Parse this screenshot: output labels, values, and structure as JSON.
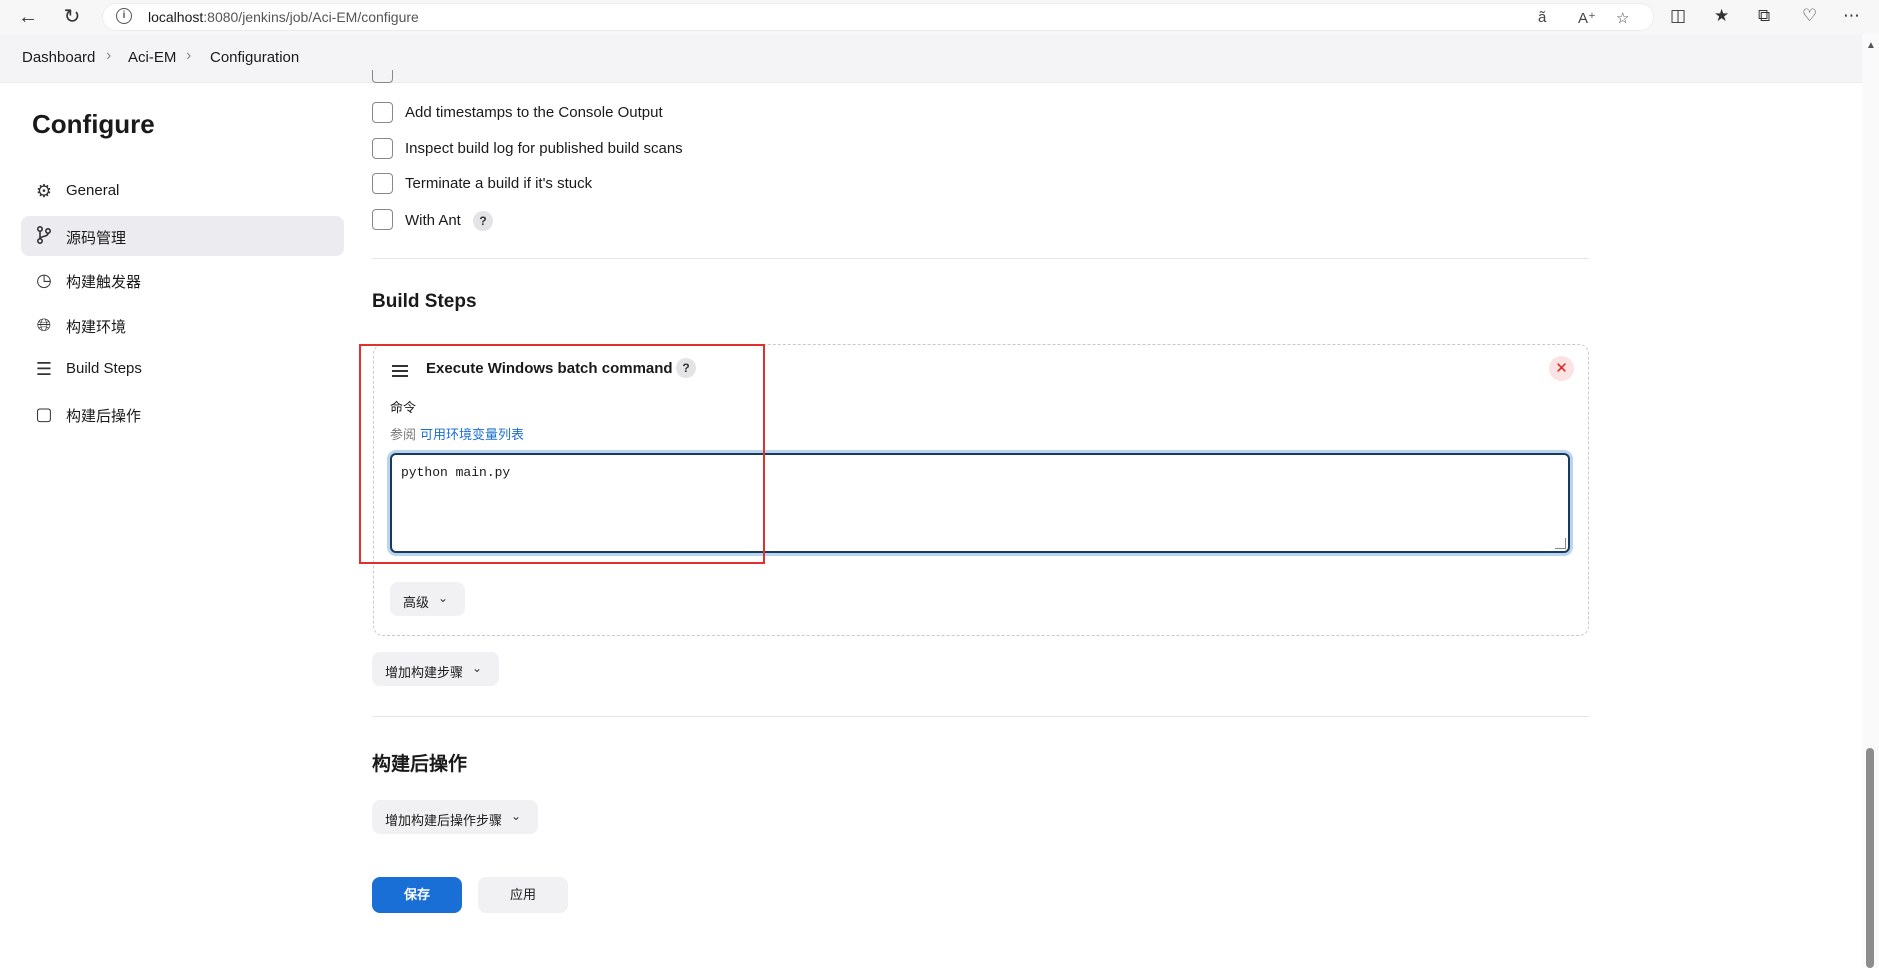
{
  "browser": {
    "url_host": "localhost",
    "url_rest": ":8080/jenkins/job/Aci-EM/configure"
  },
  "breadcrumb": [
    "Dashboard",
    "Aci-EM",
    "Configuration"
  ],
  "sidebar": {
    "title": "Configure",
    "items": [
      {
        "label": "General",
        "icon": "gear-icon"
      },
      {
        "label": "源码管理",
        "icon": "branch-icon",
        "active": true
      },
      {
        "label": "构建触发器",
        "icon": "clock-icon"
      },
      {
        "label": "构建环境",
        "icon": "globe-icon"
      },
      {
        "label": "Build Steps",
        "icon": "list-icon"
      },
      {
        "label": "构建后操作",
        "icon": "package-icon"
      }
    ]
  },
  "options": [
    {
      "label": "Add timestamps to the Console Output",
      "checked": false
    },
    {
      "label": "Inspect build log for published build scans",
      "checked": false
    },
    {
      "label": "Terminate a build if it's stuck",
      "checked": false
    },
    {
      "label": "With Ant",
      "checked": false
    }
  ],
  "help_mark": "?",
  "build_steps": {
    "title": "Build Steps",
    "step": {
      "title": "Execute Windows batch command",
      "field_label": "命令",
      "hint_prefix": "参阅",
      "hint_link": "可用环境变量列表",
      "command": "python main.py",
      "advanced_label": "高级"
    },
    "add_step_label": "增加构建步骤"
  },
  "post_build": {
    "title": "构建后操作",
    "add_label": "增加构建后操作步骤"
  },
  "actions": {
    "save": "保存",
    "apply": "应用"
  },
  "colors": {
    "primary": "#1a6fd6",
    "highlight_box": "#e03030"
  }
}
